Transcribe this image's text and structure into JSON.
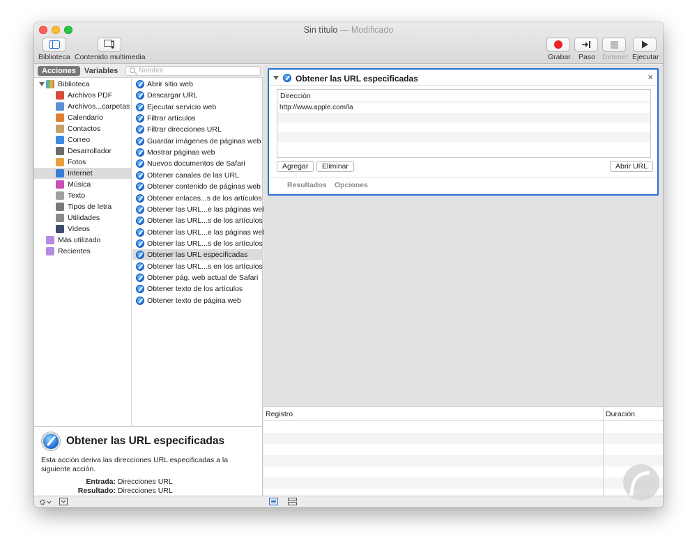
{
  "window": {
    "title": "Sin título",
    "modified": "— Modificado"
  },
  "toolbar": {
    "biblioteca": "Biblioteca",
    "multimedia": "Contenido multimedia",
    "grabar": "Grabar",
    "paso": "Paso",
    "detener": "Detener",
    "ejecutar": "Ejecutar"
  },
  "library_header": {
    "tab_acciones": "Acciones",
    "tab_variables": "Variables",
    "search_placeholder": "Nombre"
  },
  "library": {
    "root": "Biblioteca",
    "items": [
      "Archivos PDF",
      "Archivos...carpetas",
      "Calendario",
      "Contactos",
      "Correo",
      "Desarrollador",
      "Fotos",
      "Internet",
      "Música",
      "Texto",
      "Tipos de letra",
      "Utilidades",
      "Videos"
    ],
    "selected_index": 7,
    "extras": [
      "Más utilizado",
      "Recientes"
    ]
  },
  "actions": {
    "items": [
      "Abrir sitio web",
      "Descargar URL",
      "Ejecutar servicio web",
      "Filtrar artículos",
      "Filtrar direcciones URL",
      "Guardar imágenes de páginas web",
      "Mostrar páginas web",
      "Nuevos documentos de Safari",
      "Obtener canales de las URL",
      "Obtener contenido de páginas web",
      "Obtener enlaces...s de los artículos",
      "Obtener las URL...e las páginas web",
      "Obtener las URL...s de los artículos",
      "Obtener las URL...e las páginas web",
      "Obtener las URL...s de los artículos",
      "Obtener las URL especificadas",
      "Obtener las URL...s en los artículos",
      "Obtener pág. web actual de Safari",
      "Obtener texto de los artículos",
      "Obtener texto de página web"
    ],
    "selected_index": 15
  },
  "description": {
    "title": "Obtener las URL especificadas",
    "text": "Esta acción deriva las direcciones URL especificadas a la siguiente acción.",
    "input_label": "Entrada:",
    "input_value": "Direcciones URL",
    "result_label": "Resultado:",
    "result_value": "Direcciones URL"
  },
  "action_card": {
    "title": "Obtener las URL especificadas",
    "close": "×",
    "column_header": "Dirección",
    "rows": [
      "http://www.apple.com/la"
    ],
    "btn_add": "Agregar",
    "btn_remove": "Eliminar",
    "btn_open": "Abrir URL",
    "tab_results": "Resultados",
    "tab_options": "Opciones"
  },
  "log": {
    "col_registro": "Registro",
    "col_duracion": "Duración"
  },
  "colors": {
    "selection_border": "#2a70d4",
    "record": "#e8242a"
  }
}
